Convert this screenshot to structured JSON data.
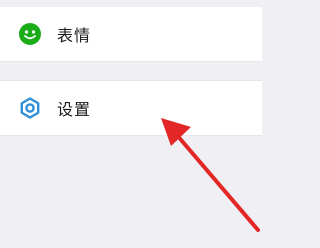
{
  "menu": {
    "items": [
      {
        "label": "表情",
        "icon": "emoji-smile-icon",
        "icon_color": "#1aad19"
      },
      {
        "label": "设置",
        "icon": "gear-icon",
        "icon_color": "#2f8fd8"
      }
    ]
  },
  "annotation": {
    "arrow_color": "#e32626"
  },
  "colors": {
    "background": "#efeff4",
    "row": "#ffffff"
  }
}
